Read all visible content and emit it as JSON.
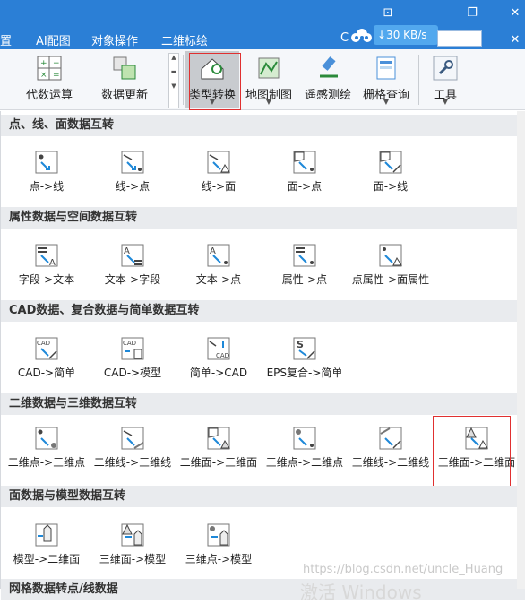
{
  "menubar": {
    "items": [
      "置",
      "AI配图",
      "对象操作",
      "二维标绘"
    ],
    "letter": "C",
    "net_speed": "↓30 KB/s"
  },
  "ribbon": {
    "buttons": [
      {
        "label": "代数运算",
        "icon": "algebra-calc-icon"
      },
      {
        "label": "数据更新",
        "icon": "data-update-icon"
      },
      {
        "label": "类型转换",
        "icon": "type-convert-icon"
      },
      {
        "label": "地图制图",
        "icon": "map-making-icon"
      },
      {
        "label": "遥感测绘",
        "icon": "remote-sensing-icon"
      },
      {
        "label": "栅格查询",
        "icon": "raster-query-icon"
      },
      {
        "label": "工具",
        "icon": "wrench-icon"
      }
    ]
  },
  "sections": [
    {
      "title": "点、线、面数据互转",
      "tools": [
        "点->线",
        "线->点",
        "线->面",
        "面->点",
        "面->线"
      ]
    },
    {
      "title": "属性数据与空间数据互转",
      "tools": [
        "字段->文本",
        "文本->字段",
        "文本->点",
        "属性->点",
        "点属性->面属性"
      ]
    },
    {
      "title": "CAD数据、复合数据与简单数据互转",
      "tools": [
        "CAD->简单",
        "CAD->模型",
        "简单->CAD",
        "EPS复合->简单"
      ]
    },
    {
      "title": "二维数据与三维数据互转",
      "tools": [
        "二维点->三维点",
        "二维线->三维线",
        "二维面->三维面",
        "三维点->二维点",
        "三维线->二维线",
        "三维面->二维面"
      ]
    },
    {
      "title": "面数据与模型数据互转",
      "tools": [
        "模型->二维面",
        "三维面->模型",
        "三维点->模型"
      ]
    },
    {
      "title": "网格数据转点/线数据",
      "tools": []
    }
  ],
  "watermark": "https://blog.csdn.net/uncle_Huang",
  "windows_watermark": "激活 Windows",
  "colors": {
    "titlebar": "#2b7fd6",
    "accent_icon": "#1e88d8",
    "highlight_box": "#e03030"
  }
}
